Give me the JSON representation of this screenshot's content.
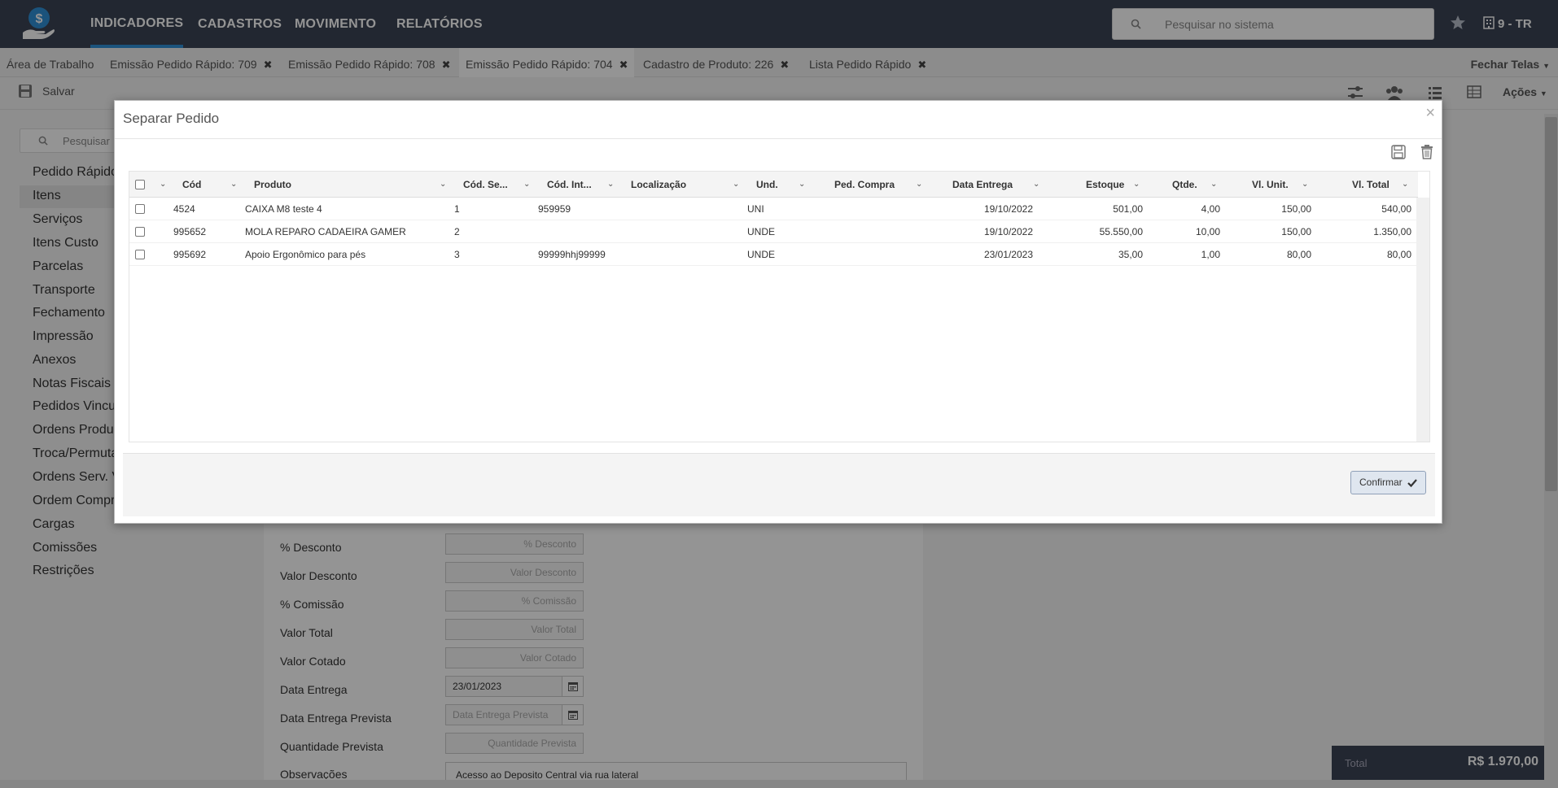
{
  "nav": {
    "items": [
      "INDICADORES",
      "CADASTROS",
      "MOVIMENTO",
      "RELATÓRIOS"
    ],
    "search_placeholder": "Pesquisar no sistema",
    "company": "9 - TR"
  },
  "tabs": {
    "workspace": "Área de Trabalho",
    "items": [
      "Emissão Pedido Rápido: 709",
      "Emissão Pedido Rápido: 708",
      "Emissão Pedido Rápido: 704",
      "Cadastro de Produto: 226",
      "Lista Pedido Rápido"
    ],
    "close_all": "Fechar Telas"
  },
  "toolbar": {
    "save_label": "Salvar",
    "actions_label": "Ações"
  },
  "sidebar": {
    "search_placeholder": "Pesquisar",
    "items": [
      "Pedido Rápido",
      "Itens",
      "Serviços",
      "Itens Custo",
      "Parcelas",
      "Transporte",
      "Fechamento",
      "Impressão",
      "Anexos",
      "Notas Fiscais V",
      "Pedidos Vincu",
      "Ordens Produç",
      "Troca/Permuta",
      "Ordens Serv. V",
      "Ordem Compr",
      "Cargas",
      "Comissões",
      "Restrições"
    ]
  },
  "form": {
    "fields": [
      {
        "label": "% Desconto",
        "placeholder": "% Desconto"
      },
      {
        "label": "Valor Desconto",
        "placeholder": "Valor Desconto"
      },
      {
        "label": "% Comissão",
        "placeholder": "% Comissão"
      },
      {
        "label": "Valor Total",
        "placeholder": "Valor Total"
      },
      {
        "label": "Valor Cotado",
        "placeholder": "Valor Cotado"
      }
    ],
    "data_entrega_label": "Data Entrega",
    "data_entrega_value": "23/01/2023",
    "data_prevista_label": "Data Entrega Prevista",
    "data_prevista_placeholder": "Data Entrega Prevista",
    "qtd_prevista_label": "Quantidade Prevista",
    "qtd_prevista_placeholder": "Quantidade Prevista",
    "obs_label": "Observações",
    "obs_value": "Acesso ao Deposito Central via rua lateral"
  },
  "total": {
    "label": "Total",
    "value": "R$ 1.970,00"
  },
  "modal": {
    "title": "Separar Pedido",
    "columns": [
      "Cód",
      "Produto",
      "Cód. Se...",
      "Cód. Int...",
      "Localização",
      "Und.",
      "Ped. Compra",
      "Data Entrega",
      "Estoque",
      "Qtde.",
      "Vl. Unit.",
      "Vl. Total"
    ],
    "rows": [
      {
        "cod": "4524",
        "produto": "CAIXA M8 teste 4",
        "cod_seq": "1",
        "cod_int": "959959",
        "localizacao": "",
        "und": "UNI",
        "ped_compra": "",
        "data_entrega": "19/10/2022",
        "estoque": "501,00",
        "qtde": "4,00",
        "vl_unit": "150,00",
        "vl_total": "540,00"
      },
      {
        "cod": "995652",
        "produto": "MOLA REPARO CADAEIRA GAMER",
        "cod_seq": "2",
        "cod_int": "",
        "localizacao": "",
        "und": "UNDE",
        "ped_compra": "",
        "data_entrega": "19/10/2022",
        "estoque": "55.550,00",
        "qtde": "10,00",
        "vl_unit": "150,00",
        "vl_total": "1.350,00"
      },
      {
        "cod": "995692",
        "produto": "Apoio Ergonômico para pés",
        "cod_seq": "3",
        "cod_int": "99999hhj99999",
        "localizacao": "",
        "und": "UNDE",
        "ped_compra": "",
        "data_entrega": "23/01/2023",
        "estoque": "35,00",
        "qtde": "1,00",
        "vl_unit": "80,00",
        "vl_total": "80,00"
      }
    ],
    "confirm_label": "Confirmar"
  },
  "colors": {
    "navbar": "#3b4455",
    "accent": "#2f8fd6"
  }
}
